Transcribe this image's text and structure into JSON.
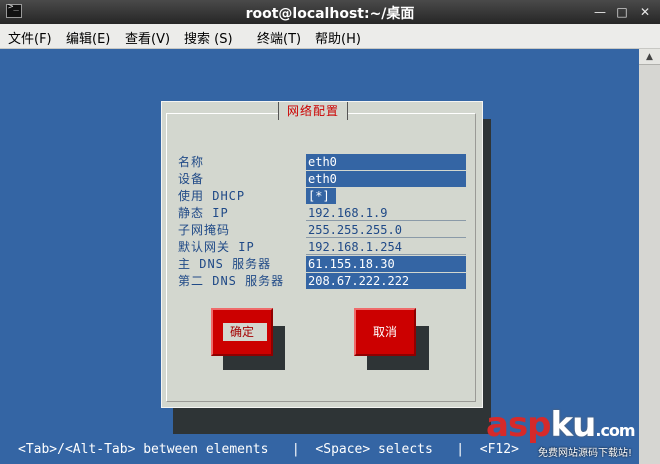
{
  "window": {
    "title": "root@localhost:~/桌面"
  },
  "menu": [
    {
      "label": "文件(F)"
    },
    {
      "label": "编辑(E)"
    },
    {
      "label": "查看(V)"
    },
    {
      "label": "搜索 (S)"
    },
    {
      "label": "终端(T)"
    },
    {
      "label": "帮助(H)"
    }
  ],
  "dialog": {
    "title": "网络配置",
    "fields": [
      {
        "label": "名称",
        "value": "eth0"
      },
      {
        "label": "设备",
        "value": "eth0"
      },
      {
        "label": "使用 DHCP",
        "value": "[*]"
      },
      {
        "label": "静态 IP",
        "value": "192.168.1.9"
      },
      {
        "label": "子网掩码",
        "value": "255.255.255.0"
      },
      {
        "label": "默认网关 IP",
        "value": "192.168.1.254"
      },
      {
        "label": "主 DNS 服务器",
        "value": "61.155.18.30"
      },
      {
        "label": "第二 DNS 服务器",
        "value": "208.67.222.222"
      }
    ],
    "ok_label": "确定",
    "cancel_label": "取消"
  },
  "hint": "<Tab>/<Alt-Tab> between elements   |  <Space> selects   |  <F12>",
  "watermark": {
    "asp": "asp",
    "ku": "ku",
    "com": ".com",
    "subtitle": "免费网站源码下载站!"
  },
  "colors": {
    "terminal_background": "#3465a4",
    "dialog_background": "#d3d7cf",
    "accent_red": "#cc0000",
    "label_blue": "#204a87"
  },
  "icons": {
    "window_icon": "terminal-icon",
    "minimize": "minimize-icon",
    "maximize": "maximize-icon",
    "close": "close-icon"
  }
}
